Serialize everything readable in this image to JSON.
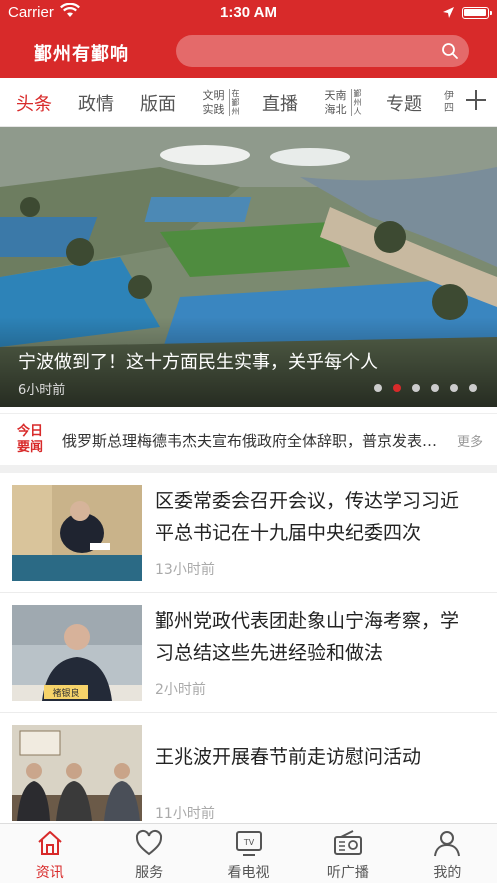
{
  "status_bar": {
    "carrier": "Carrier",
    "time": "1:30 AM",
    "battery_level": 1.0
  },
  "header": {
    "title": "鄞州有鄞响",
    "search_placeholder": ""
  },
  "tabs": [
    {
      "label": "头条",
      "active": true
    },
    {
      "label": "政情"
    },
    {
      "label": "版面"
    },
    {
      "label": "文明实践",
      "side": "在鄞州"
    },
    {
      "label": "直播"
    },
    {
      "label": "天南海北",
      "side": "鄞州人"
    },
    {
      "label": "专题"
    },
    {
      "label": "伊四"
    }
  ],
  "banner": {
    "caption": "宁波做到了！这十方面民生实事，关乎每个人",
    "time": "6小时前",
    "slide_count": 6,
    "active_slide": 2
  },
  "ticker": {
    "logo": "今日要闻",
    "text": "俄罗斯总理梅德韦杰夫宣布俄政府全体辞职，普京发表电视讲话",
    "more": "更多"
  },
  "news": [
    {
      "title": "区委常委会召开会议，传达学习习近平总书记在十九届中央纪委四次",
      "time": "13小时前"
    },
    {
      "title": "鄞州党政代表团赴象山宁海考察，学习总结这些先进经验和做法",
      "time": "2小时前",
      "nameplate": "褚银良"
    },
    {
      "title": "王兆波开展春节前走访慰问活动",
      "time": "11小时前"
    }
  ],
  "tabbar": [
    {
      "label": "资讯",
      "icon": "home-icon",
      "active": true
    },
    {
      "label": "服务",
      "icon": "heart-icon"
    },
    {
      "label": "看电视",
      "icon": "tv-icon"
    },
    {
      "label": "听广播",
      "icon": "radio-icon"
    },
    {
      "label": "我的",
      "icon": "user-icon"
    }
  ],
  "colors": {
    "brand": "#d82a2a",
    "background": "#ffffff",
    "muted": "#aaaaaa"
  }
}
